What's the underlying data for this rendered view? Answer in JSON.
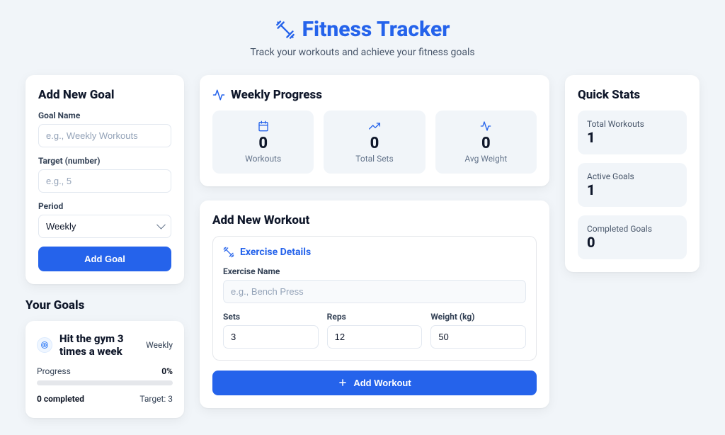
{
  "header": {
    "title": "Fitness Tracker",
    "subtitle": "Track your workouts and achieve your fitness goals"
  },
  "goal_form": {
    "title": "Add New Goal",
    "name_label": "Goal Name",
    "name_placeholder": "e.g., Weekly Workouts",
    "target_label": "Target (number)",
    "target_placeholder": "e.g., 5",
    "period_label": "Period",
    "period_value": "Weekly",
    "button": "Add Goal"
  },
  "goals": {
    "title": "Your Goals",
    "items": [
      {
        "name": "Hit the gym 3 times a week",
        "period": "Weekly",
        "progress_label": "Progress",
        "progress_value": "0%",
        "completed_text": "0 completed",
        "target_text": "Target: 3"
      }
    ]
  },
  "weekly": {
    "title": "Weekly Progress",
    "stats": [
      {
        "value": "0",
        "label": "Workouts",
        "icon": "calendar"
      },
      {
        "value": "0",
        "label": "Total Sets",
        "icon": "trending"
      },
      {
        "value": "0",
        "label": "Avg Weight",
        "icon": "activity"
      }
    ]
  },
  "workout_form": {
    "title": "Add New Workout",
    "section_title": "Exercise Details",
    "exercise_label": "Exercise Name",
    "exercise_placeholder": "e.g., Bench Press",
    "sets_label": "Sets",
    "sets_value": "3",
    "reps_label": "Reps",
    "reps_value": "12",
    "weight_label": "Weight (kg)",
    "weight_value": "50",
    "button": "Add Workout"
  },
  "quick_stats": {
    "title": "Quick Stats",
    "items": [
      {
        "label": "Total Workouts",
        "value": "1"
      },
      {
        "label": "Active Goals",
        "value": "1"
      },
      {
        "label": "Completed Goals",
        "value": "0"
      }
    ]
  }
}
